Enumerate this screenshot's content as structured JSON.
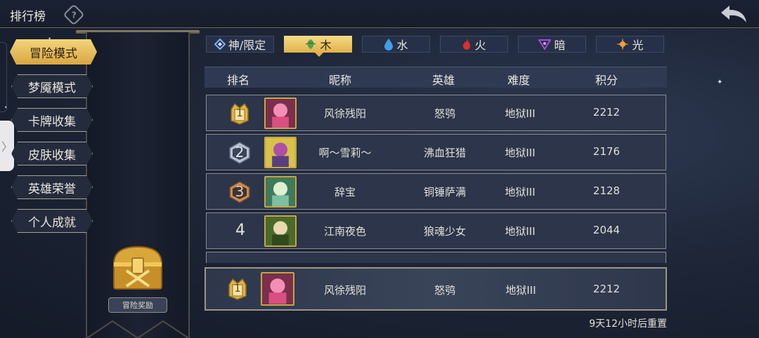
{
  "header": {
    "title": "排行榜"
  },
  "sidebar": {
    "items": [
      {
        "label": "冒险模式",
        "active": true
      },
      {
        "label": "梦魇模式",
        "active": false
      },
      {
        "label": "卡牌收集",
        "active": false
      },
      {
        "label": "皮肤收集",
        "active": false
      },
      {
        "label": "英雄荣誉",
        "active": false
      },
      {
        "label": "个人成就",
        "active": false
      }
    ],
    "reward_label": "冒险奖励"
  },
  "element_tabs": [
    {
      "label": "神/限定",
      "icon": "diamond-icon",
      "color": "#7fb3ff",
      "active": false
    },
    {
      "label": "木",
      "icon": "leaf-icon",
      "color": "#4fa24f",
      "active": true
    },
    {
      "label": "水",
      "icon": "water-drop-icon",
      "color": "#3fa0e8",
      "active": false
    },
    {
      "label": "火",
      "icon": "flame-icon",
      "color": "#d8302c",
      "active": false
    },
    {
      "label": "暗",
      "icon": "dark-sigil-icon",
      "color": "#a24fd8",
      "active": false
    },
    {
      "label": "光",
      "icon": "sun-icon",
      "color": "#f0a040",
      "active": false
    }
  ],
  "table": {
    "columns": [
      "排名",
      "昵称",
      "英雄",
      "难度",
      "积分"
    ],
    "rows": [
      {
        "rank": "1",
        "nickname": "风徐残阳",
        "hero": "怒鸮",
        "difficulty": "地狱III",
        "score": "2212"
      },
      {
        "rank": "2",
        "nickname": "啊～雪莉～",
        "hero": "沸血狂猎",
        "difficulty": "地狱III",
        "score": "2176"
      },
      {
        "rank": "3",
        "nickname": "辞宝",
        "hero": "铜锤萨满",
        "difficulty": "地狱III",
        "score": "2128"
      },
      {
        "rank": "4",
        "nickname": "江南夜色",
        "hero": "狼魂少女",
        "difficulty": "地狱III",
        "score": "2044"
      }
    ]
  },
  "my_entry": {
    "rank": "1",
    "nickname": "风徐残阳",
    "hero": "怒鸮",
    "difficulty": "地狱III",
    "score": "2212"
  },
  "reset_text": "9天12小时后重置",
  "colors": {
    "gold": "#e2b24b",
    "silver": "#b8c2d4",
    "bronze": "#c98a58",
    "panel": "#2c3549"
  }
}
